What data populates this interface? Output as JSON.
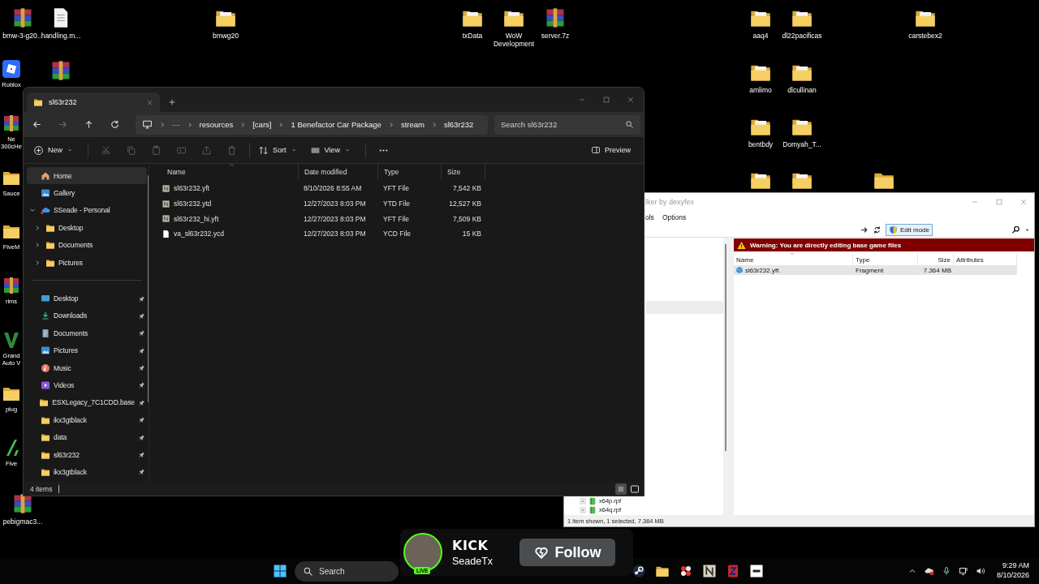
{
  "desktop": {
    "icons": [
      {
        "kind": "archive",
        "label": "bmw-3-g20..."
      },
      {
        "kind": "document",
        "label": "handling.m..."
      },
      {
        "kind": "folder_paper",
        "label": "bmwg20"
      },
      {
        "kind": "folder_paper",
        "label": "txData"
      },
      {
        "kind": "folder_paper",
        "label": "WoW Development"
      },
      {
        "kind": "archive",
        "label": "server.7z"
      },
      {
        "kind": "folder_paper",
        "label": "aaq4"
      },
      {
        "kind": "folder_paper",
        "label": "dl22pacificas"
      },
      {
        "kind": "folder_paper",
        "label": "carstebex2"
      },
      {
        "kind": "roblox",
        "label": "Roblox"
      },
      {
        "kind": "archive"
      },
      {
        "kind": "folder_paper",
        "label": "amlimo"
      },
      {
        "kind": "folder_paper",
        "label": "dlcullinan"
      },
      {
        "kind": "archive",
        "label": "Ne 300cHe"
      },
      {
        "kind": "folder_paper",
        "label": "bentbdy"
      },
      {
        "kind": "folder_paper",
        "label": "Domyah_T..."
      },
      {
        "kind": "folder",
        "label": "Sauce"
      },
      {
        "kind": "folder_paper"
      },
      {
        "kind": "folder_paper"
      },
      {
        "kind": "folder"
      },
      {
        "kind": "folder",
        "label": "FiveM"
      },
      {
        "kind": "archive",
        "label": "rims"
      },
      {
        "kind": "gta",
        "label": "Grand Auto V"
      },
      {
        "kind": "folder",
        "label": "plug"
      },
      {
        "kind": "fivem",
        "label": "Five"
      },
      {
        "kind": "archive",
        "label": "pebigmac3..."
      }
    ]
  },
  "explorer": {
    "tabs": [
      {
        "title": "sl63r232",
        "selected": true
      }
    ],
    "nav_buttons": [
      {
        "kind": "back",
        "disabled": false
      },
      {
        "kind": "forward",
        "disabled": true
      },
      {
        "kind": "up",
        "disabled": false
      },
      {
        "kind": "refresh",
        "disabled": false
      }
    ],
    "breadcrumb_overflow": "···",
    "breadcrumb": [
      "resources",
      "[cars]",
      "1 Benefactor Car Package",
      "stream",
      "sl63r232"
    ],
    "search": {
      "placeholder": "Search sl63r232"
    },
    "toolbar": [
      {
        "kind": "new",
        "label": "New",
        "disabled": false
      },
      {
        "kind": "cut",
        "disabled": true
      },
      {
        "kind": "copy",
        "disabled": true
      },
      {
        "kind": "paste",
        "disabled": true
      },
      {
        "kind": "rename",
        "disabled": true
      },
      {
        "kind": "share",
        "disabled": true
      },
      {
        "kind": "delete",
        "disabled": true
      },
      {
        "kind": "sort",
        "label": "Sort",
        "disabled": false
      },
      {
        "kind": "view",
        "label": "View",
        "disabled": false
      },
      {
        "kind": "more",
        "disabled": false
      }
    ],
    "preview_button": "Preview",
    "sidebar": {
      "items": [
        {
          "kind": "home",
          "label": "Home",
          "selected": true
        },
        {
          "kind": "gallery",
          "label": "Gallery",
          "selected": false
        },
        {
          "kind": "cloud",
          "label": "SSeade - Personal",
          "selected": false,
          "expanded": true,
          "children": [
            {
              "kind": "folder",
              "label": "Desktop",
              "selected": false,
              "expanded": false
            },
            {
              "kind": "folder",
              "label": "Documents",
              "selected": false,
              "expanded": false
            },
            {
              "kind": "folder",
              "label": "Pictures",
              "selected": false,
              "expanded": false
            }
          ]
        }
      ],
      "pinned": [
        {
          "kind": "desktop",
          "label": "Desktop",
          "selected": false
        },
        {
          "kind": "downloads",
          "label": "Downloads",
          "selected": false
        },
        {
          "kind": "documents",
          "label": "Documents",
          "selected": false
        },
        {
          "kind": "pictures",
          "label": "Pictures",
          "selected": false
        },
        {
          "kind": "music",
          "label": "Music",
          "selected": false
        },
        {
          "kind": "videos",
          "label": "Videos",
          "selected": false
        },
        {
          "kind": "folder",
          "label": "ESXLegacy_7C1CDD.base",
          "selected": false
        },
        {
          "kind": "folder",
          "label": "ikx3gtblack",
          "selected": false
        },
        {
          "kind": "folder",
          "label": "data",
          "selected": false
        },
        {
          "kind": "folder",
          "label": "sl63r232",
          "selected": false
        },
        {
          "kind": "folder",
          "label": "ikx3gtblack",
          "selected": false
        }
      ]
    },
    "files": {
      "columns": [
        "Name",
        "Date modified",
        "Type",
        "Size"
      ],
      "rows": [
        {
          "kind": "n_file",
          "name": "sl63r232.yft",
          "date": "8/10/2026 8:55 AM",
          "type": "YFT File",
          "size": "7,542 KB"
        },
        {
          "kind": "n_file",
          "name": "sl63r232.ytd",
          "date": "12/27/2023 8:03 PM",
          "type": "YTD File",
          "size": "12,527 KB"
        },
        {
          "kind": "n_file",
          "name": "sl63r232_hi.yft",
          "date": "12/27/2023 8:03 PM",
          "type": "YFT File",
          "size": "7,509 KB"
        },
        {
          "kind": "blank_file",
          "name": "va_sl63r232.ycd",
          "date": "12/27/2023 8:03 PM",
          "type": "YCD File",
          "size": "15 KB"
        }
      ]
    },
    "status_bar": {
      "count": "4 items"
    },
    "view_modes": [
      {
        "kind": "details",
        "selected": true
      },
      {
        "kind": "tiles",
        "selected": false
      }
    ]
  },
  "codewalker": {
    "title": "lker by dexyfex",
    "menu": [
      "ols",
      "Options"
    ],
    "edit_mode": {
      "label": "Edit mode",
      "on": true
    },
    "warning": "Warning: You are directly editing base game files",
    "columns": [
      "Name",
      "Type",
      "Size",
      "Attributes"
    ],
    "rows": [
      {
        "name": "sl63r232.yft",
        "type": "Fragment",
        "size": "7.364 MB",
        "selected": true
      }
    ],
    "tree": [
      {
        "label": "x64p.rpf",
        "expanded": false
      },
      {
        "label": "x64q.rpf",
        "expanded": false
      }
    ],
    "status": "1 item shown, 1 selected, 7.364 MB"
  },
  "kick_overlay": {
    "logo": "KICK",
    "channel": "SeadeTx",
    "badge": "LIVE",
    "follow": "Follow"
  },
  "taskbar": {
    "search_placeholder": "Search",
    "apps": [
      {
        "kind": "steam"
      },
      {
        "kind": "folder"
      },
      {
        "kind": "flower"
      },
      {
        "kind": "n_app"
      },
      {
        "kind": "z_app"
      },
      {
        "kind": "esx"
      }
    ],
    "tray": [
      {
        "kind": "chevron_up"
      },
      {
        "kind": "cloud_x"
      },
      {
        "kind": "mic"
      },
      {
        "kind": "network"
      },
      {
        "kind": "speaker"
      }
    ],
    "time": "9:29 AM",
    "date": "8/10/2026"
  }
}
